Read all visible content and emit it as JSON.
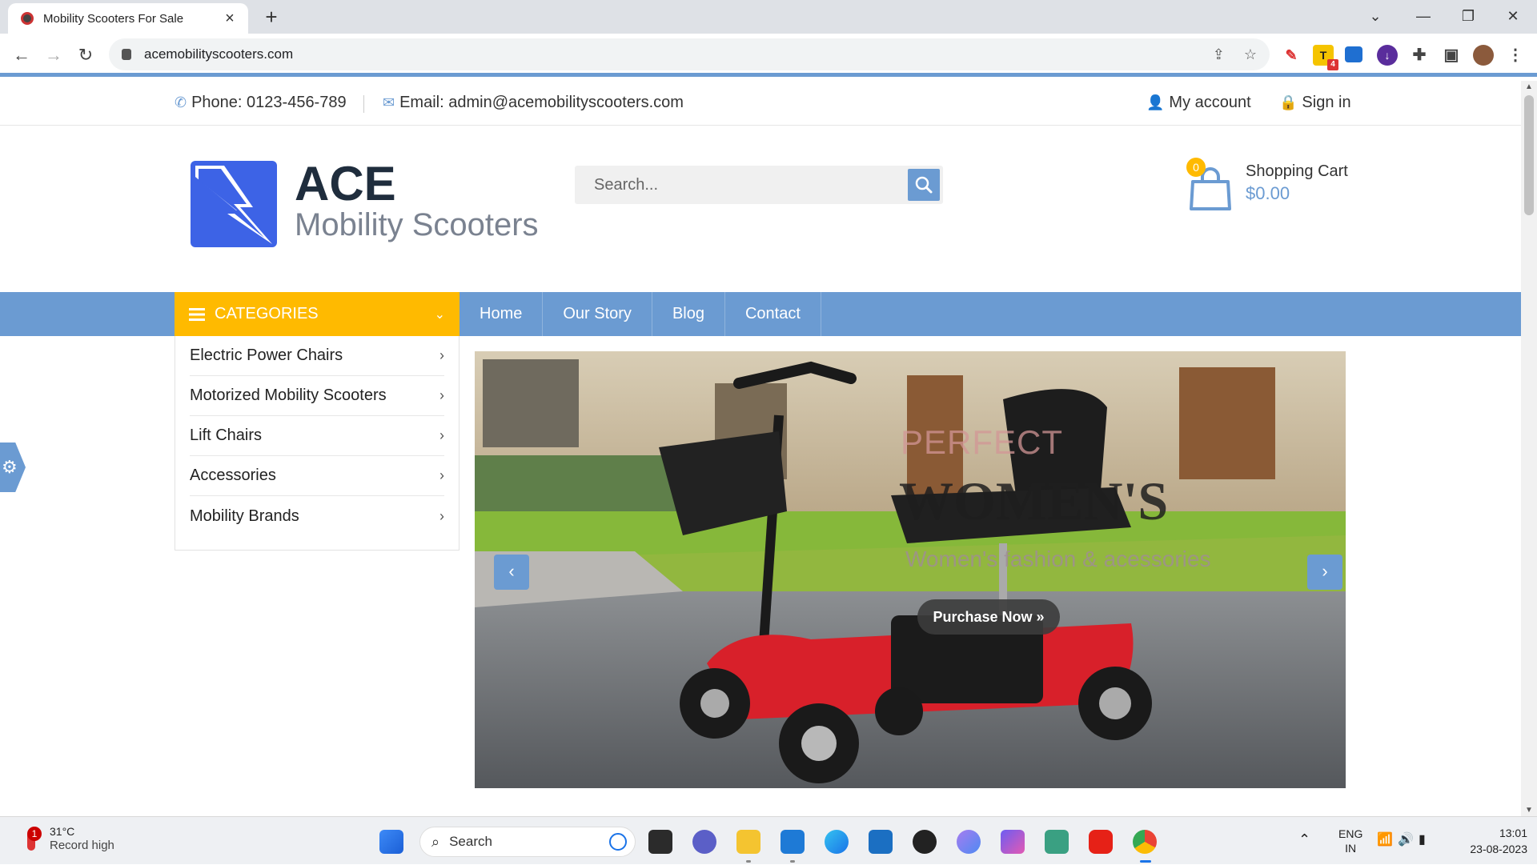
{
  "browser": {
    "tab_title": "Mobility Scooters For Sale",
    "url": "acemobilityscooters.com",
    "extension_badge": "4"
  },
  "topbar": {
    "phone": "Phone: 0123-456-789",
    "email": "Email: admin@acemobilityscooters.com",
    "my_account": "My account",
    "sign_in": "Sign in"
  },
  "logo": {
    "title": "ACE",
    "subtitle": "Mobility Scooters"
  },
  "search": {
    "placeholder": "Search..."
  },
  "cart": {
    "count": "0",
    "label": "Shopping Cart",
    "total": "$0.00"
  },
  "nav": {
    "categories_label": "CATEGORIES",
    "menu": [
      {
        "label": "Home"
      },
      {
        "label": "Our Story"
      },
      {
        "label": "Blog"
      },
      {
        "label": "Contact"
      }
    ]
  },
  "categories": [
    {
      "label": "Electric Power Chairs"
    },
    {
      "label": "Motorized Mobility Scooters"
    },
    {
      "label": "Lift Chairs"
    },
    {
      "label": "Accessories"
    },
    {
      "label": "Mobility Brands"
    }
  ],
  "slider": {
    "line1": "PERFECT",
    "line2": "WOMEN'S",
    "line3": "Women's fashion & acessories",
    "cta": "Purchase Now »"
  },
  "taskbar": {
    "temperature": "31°C",
    "weather_note": "Record high",
    "weather_badge": "1",
    "search_label": "Search",
    "lang_primary": "ENG",
    "lang_secondary": "IN",
    "time": "13:01",
    "date": "23-08-2023"
  },
  "colors": {
    "accent": "#6b9bd2",
    "categories": "#ffba00",
    "logo_blue": "#3d63e6"
  }
}
